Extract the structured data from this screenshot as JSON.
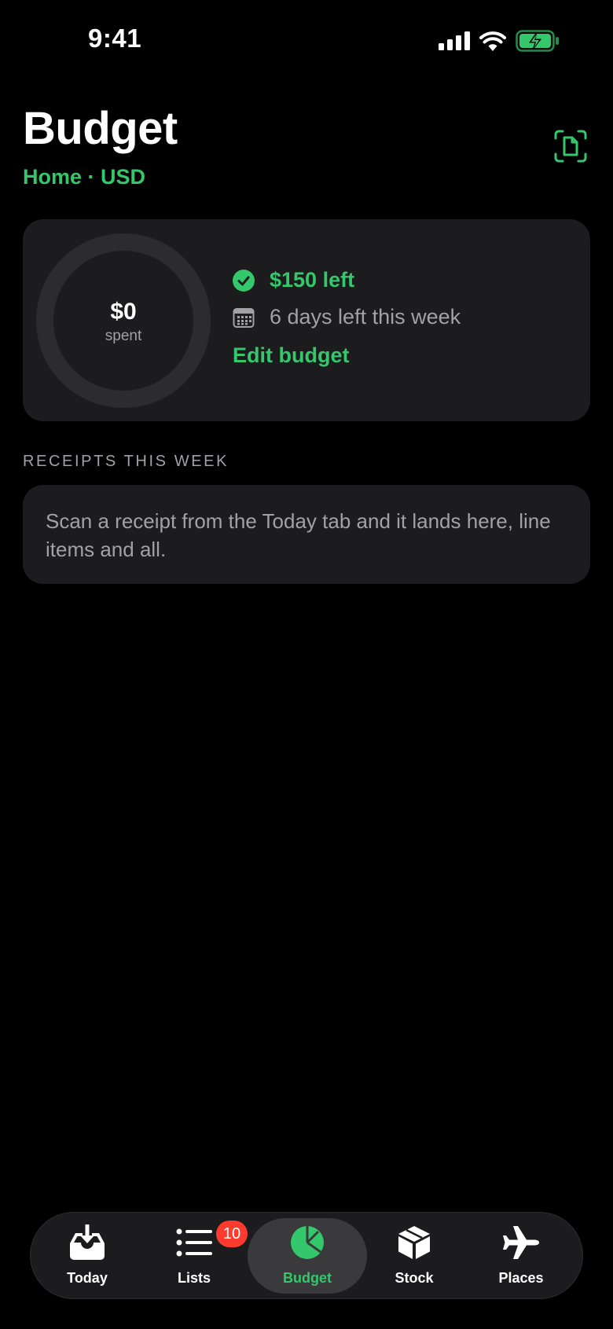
{
  "status_bar": {
    "time": "9:41",
    "icons": [
      "cellular-signal-icon",
      "wifi-icon",
      "battery-charging-icon"
    ]
  },
  "header": {
    "title": "Budget",
    "subtitle": "Home · USD",
    "scan_icon": "doc-scan-icon"
  },
  "budget_card": {
    "spent_amount": "$0",
    "spent_label": "spent",
    "spent_fraction": 0,
    "left_text": "$150 left",
    "days_text": "6 days left this week",
    "edit_label": "Edit budget"
  },
  "receipts": {
    "header": "RECEIPTS THIS WEEK",
    "empty_text": "Scan a receipt from the Today tab and it lands here, line items and all."
  },
  "tab_bar": {
    "items": [
      {
        "label": "Today",
        "icon": "tray-download-icon"
      },
      {
        "label": "Lists",
        "icon": "list-icon",
        "badge": "10"
      },
      {
        "label": "Budget",
        "icon": "pie-chart-icon",
        "active": true
      },
      {
        "label": "Stock",
        "icon": "box-icon"
      },
      {
        "label": "Places",
        "icon": "airplane-icon"
      }
    ]
  },
  "colors": {
    "accent": "#34c76b",
    "background": "#000000",
    "card": "#1c1c1e",
    "secondary_text": "#a1a1a6",
    "badge": "#ff3b30"
  }
}
